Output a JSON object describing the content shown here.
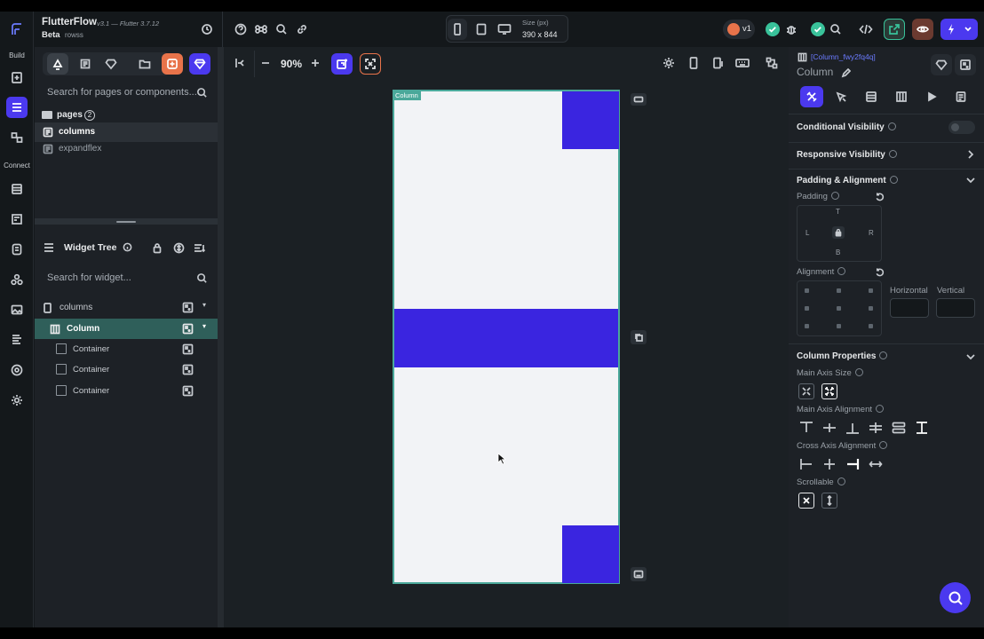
{
  "topbar": {
    "app_name": "FlutterFlow",
    "version": "v3.1 — Flutter 3.7.12",
    "beta": "Beta",
    "project": "rowss",
    "size_label": "Size (px)",
    "size_value": "390 x 844",
    "version_badge": "v1",
    "accent": "#4b39ef"
  },
  "rail": {
    "build_label": "Build",
    "connect_label": "Connect"
  },
  "left_panel": {
    "search_pages_placeholder": "Search for pages or components...",
    "pages_label": "pages",
    "pages_count": "2",
    "pages": [
      {
        "label": "columns",
        "selected": true
      },
      {
        "label": "expandflex",
        "selected": false
      }
    ],
    "widget_tree_title": "Widget Tree",
    "search_widget_placeholder": "Search for widget...",
    "tree": [
      {
        "label": "columns"
      },
      {
        "label": "Column"
      },
      {
        "label": "Container"
      },
      {
        "label": "Container"
      },
      {
        "label": "Container"
      }
    ]
  },
  "canvas": {
    "zoom": "90%",
    "selected_tag": "Column",
    "container_color": "#3a25e0",
    "background": "#f2f3f6"
  },
  "properties": {
    "widget_id": "[Column_fwy2fq4q]",
    "widget_type": "Column",
    "conditional_visibility": "Conditional Visibility",
    "conditional_visibility_on": false,
    "responsive_visibility": "Responsive Visibility",
    "padding_alignment": "Padding & Alignment",
    "padding": "Padding",
    "pad_t": "T",
    "pad_l": "L",
    "pad_r": "R",
    "pad_b": "B",
    "alignment": "Alignment",
    "horizontal": "Horizontal",
    "vertical": "Vertical",
    "column_properties": "Column Properties",
    "main_axis_size": "Main Axis Size",
    "main_axis_alignment": "Main Axis Alignment",
    "cross_axis_alignment": "Cross Axis Alignment",
    "scrollable": "Scrollable"
  }
}
